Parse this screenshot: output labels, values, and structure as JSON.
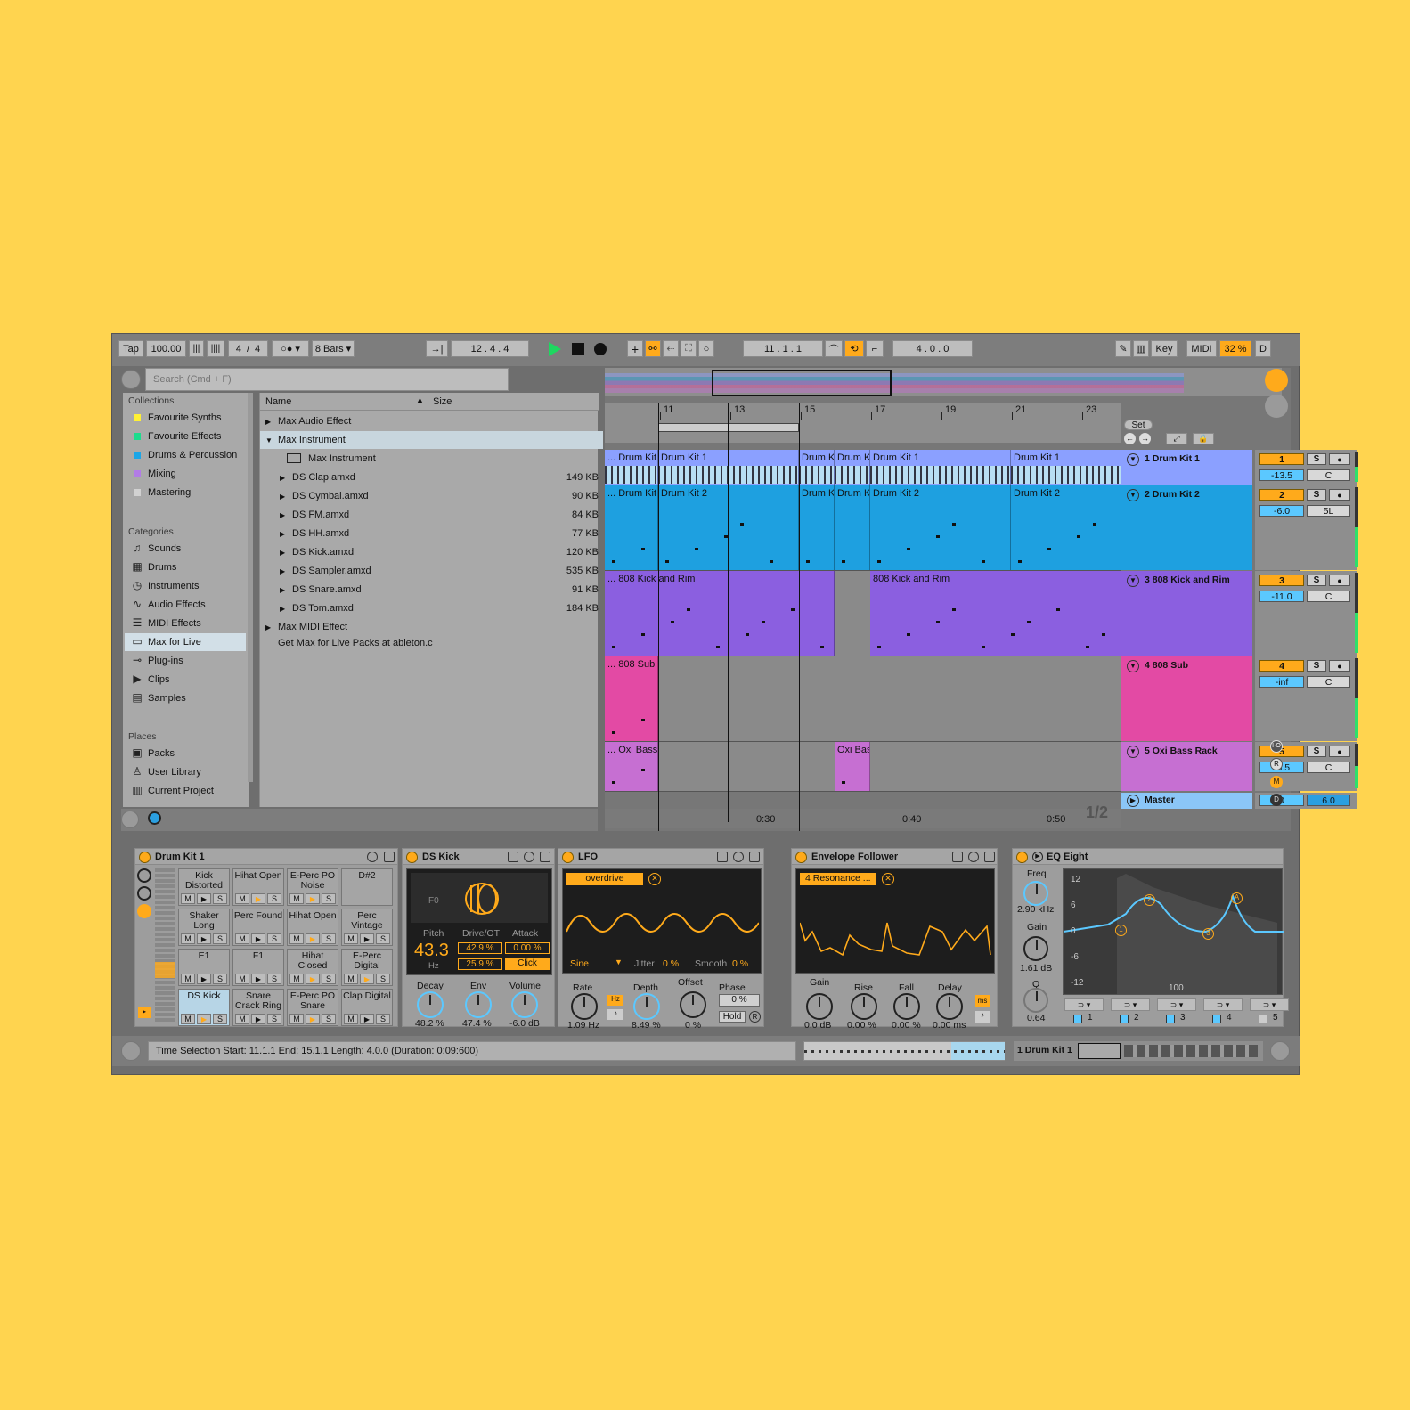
{
  "transport": {
    "tap": "Tap",
    "tempo": "100.00",
    "sig_num": "4",
    "sig_sep": "/",
    "sig_den": "4",
    "quant": "8 Bars",
    "arr_pos": "12 .   4 .   4",
    "loop_start": "11 .   1 .   1",
    "loop_len": "4 .   0 .   0",
    "key": "Key",
    "midi": "MIDI",
    "cpu": "32 %",
    "d": "D"
  },
  "browser": {
    "search_placeholder": "Search (Cmd + F)",
    "collections_head": "Collections",
    "collections": [
      {
        "label": "Favourite Synths",
        "color": "#FFF034"
      },
      {
        "label": "Favourite Effects",
        "color": "#1DDC8D"
      },
      {
        "label": "Drums & Percussion",
        "color": "#1AA6E8"
      },
      {
        "label": "Mixing",
        "color": "#B27CE6"
      },
      {
        "label": "Mastering",
        "color": "#D1D1D1"
      }
    ],
    "categories_head": "Categories",
    "categories": [
      {
        "label": "Sounds",
        "icon": "music-note-icon"
      },
      {
        "label": "Drums",
        "icon": "grid-icon"
      },
      {
        "label": "Instruments",
        "icon": "clock-icon"
      },
      {
        "label": "Audio Effects",
        "icon": "waveform-icon"
      },
      {
        "label": "MIDI Effects",
        "icon": "midi-icon"
      },
      {
        "label": "Max for Live",
        "icon": "max-icon"
      },
      {
        "label": "Plug-ins",
        "icon": "plug-icon"
      },
      {
        "label": "Clips",
        "icon": "play-clip-icon"
      },
      {
        "label": "Samples",
        "icon": "sample-icon"
      }
    ],
    "places_head": "Places",
    "places": [
      {
        "label": "Packs",
        "icon": "folder-icon"
      },
      {
        "label": "User Library",
        "icon": "user-icon"
      },
      {
        "label": "Current Project",
        "icon": "project-icon"
      }
    ],
    "col_name": "Name",
    "col_size": "Size",
    "files": [
      {
        "name": "Max Audio Effect",
        "size": "",
        "indent": 0,
        "arrow": "▶"
      },
      {
        "name": "Max Instrument",
        "size": "",
        "indent": 0,
        "arrow": "▼"
      },
      {
        "name": "Max Instrument",
        "size": "",
        "indent": 2,
        "arrow": ""
      },
      {
        "name": "DS Clap.amxd",
        "size": "149 KB",
        "indent": 1,
        "arrow": "▶"
      },
      {
        "name": "DS Cymbal.amxd",
        "size": "90 KB",
        "indent": 1,
        "arrow": "▶"
      },
      {
        "name": "DS FM.amxd",
        "size": "84 KB",
        "indent": 1,
        "arrow": "▶"
      },
      {
        "name": "DS HH.amxd",
        "size": "77 KB",
        "indent": 1,
        "arrow": "▶"
      },
      {
        "name": "DS Kick.amxd",
        "size": "120 KB",
        "indent": 1,
        "arrow": "▶"
      },
      {
        "name": "DS Sampler.amxd",
        "size": "535 KB",
        "indent": 1,
        "arrow": "▶"
      },
      {
        "name": "DS Snare.amxd",
        "size": "91 KB",
        "indent": 1,
        "arrow": "▶"
      },
      {
        "name": "DS Tom.amxd",
        "size": "184 KB",
        "indent": 1,
        "arrow": "▶"
      },
      {
        "name": "Max MIDI Effect",
        "size": "",
        "indent": 0,
        "arrow": "▶"
      }
    ],
    "get_more": "Get Max for Live Packs at ableton.c"
  },
  "arrangement": {
    "bars": [
      "11",
      "13",
      "15",
      "17",
      "19",
      "21",
      "23"
    ],
    "times": [
      "0:30",
      "0:40",
      "0:50"
    ],
    "set_label": "Set",
    "page": "1/2",
    "tracks": [
      {
        "name": "1 Drum Kit 1",
        "num": "1",
        "vol": "-13.5",
        "pan": "C",
        "color": "#8BA0FF",
        "clips": [
          "... Drum Kit",
          "Drum Kit 1",
          "Drum K",
          "Drum K",
          "Drum Kit 1",
          "Drum Kit 1"
        ]
      },
      {
        "name": "2 Drum Kit 2",
        "num": "2",
        "vol": "-6.0",
        "pan": "5L",
        "color": "#1EA0E0",
        "clips": [
          "... Drum Kit",
          "Drum Kit 2",
          "Drum K",
          "Drum K",
          "Drum Kit 2",
          "Drum Kit 2"
        ]
      },
      {
        "name": "3 808 Kick and Rim",
        "num": "3",
        "vol": "-11.0",
        "pan": "C",
        "color": "#8B5FE0",
        "clips": [
          "... 808 Kick and Rim",
          "808 Kick and Rim"
        ]
      },
      {
        "name": "4 808 Sub",
        "num": "4",
        "vol": "-inf",
        "pan": "C",
        "color": "#E34AA4",
        "clips": [
          "... 808 Sub"
        ]
      },
      {
        "name": "5 Oxi Bass Rack",
        "num": "5",
        "vol": "-5.5",
        "pan": "C",
        "color": "#C66FD2",
        "clips": [
          "... Oxi Bass",
          "Oxi Bas"
        ]
      }
    ],
    "master": {
      "name": "Master",
      "vol": "0",
      "pan": "6.0"
    }
  },
  "devices": {
    "drumkit": {
      "title": "Drum Kit 1",
      "pads": [
        "Kick Distorted",
        "Hihat Open",
        "E-Perc PO Noise",
        "D#2",
        "Shaker Long",
        "Perc Found",
        "Hihat Open",
        "Perc Vintage",
        "E1",
        "F1",
        "Hihat Closed",
        "E-Perc Digital",
        "DS Kick",
        "Snare Crack Ring",
        "E-Perc PO Snare",
        "Clap Digital"
      ],
      "m": "M",
      "s": "S"
    },
    "dskick": {
      "title": "DS Kick",
      "note": "F0",
      "pitch_label": "Pitch",
      "pitch_val": "43.3",
      "pitch_unit": "Hz",
      "drive_label": "Drive/OT",
      "drive1": "42.9 %",
      "drive2": "25.9 %",
      "attack_label": "Attack",
      "attack_val": "0.00 %",
      "click": "Click",
      "decay_label": "Decay",
      "decay_val": "48.2 %",
      "env_label": "Env",
      "env_val": "47.4 %",
      "volume_label": "Volume",
      "volume_val": "-6.0 dB"
    },
    "lfo": {
      "title": "LFO",
      "target": "overdrive",
      "shape": "Sine",
      "jitter_label": "Jitter",
      "jitter_val": "0 %",
      "smooth_label": "Smooth",
      "smooth_val": "0 %",
      "rate_label": "Rate",
      "rate_val": "1.09 Hz",
      "hz": "Hz",
      "depth_label": "Depth",
      "depth_val": "8.49 %",
      "offset_label": "Offset",
      "offset_val": "0 %",
      "phase_label": "Phase",
      "phase_val": "0 %",
      "hold": "Hold",
      "r": "R"
    },
    "envf": {
      "title": "Envelope Follower",
      "target": "4 Resonance ...",
      "gain_label": "Gain",
      "gain_val": "0.0 dB",
      "rise_label": "Rise",
      "rise_val": "0.00 %",
      "fall_label": "Fall",
      "fall_val": "0.00 %",
      "delay_label": "Delay",
      "delay_val": "0.00 ms",
      "ms": "ms"
    },
    "eq": {
      "title": "EQ Eight",
      "freq_label": "Freq",
      "freq_val": "2.90 kHz",
      "gain_label": "Gain",
      "gain_val": "1.61 dB",
      "q_label": "Q",
      "q_val": "0.64",
      "db_ticks": [
        "12",
        "6",
        "0",
        "-6",
        "-12"
      ],
      "hz_tick": "100",
      "bands": [
        "1",
        "2",
        "3",
        "4",
        "5"
      ],
      "points": [
        "1",
        "2",
        "3",
        "A"
      ]
    }
  },
  "status": {
    "text": "Time Selection    Start: 11.1.1    End: 15.1.1    Length: 4.0.0  (Duration: 0:09:600)",
    "track": "1 Drum Kit 1"
  }
}
